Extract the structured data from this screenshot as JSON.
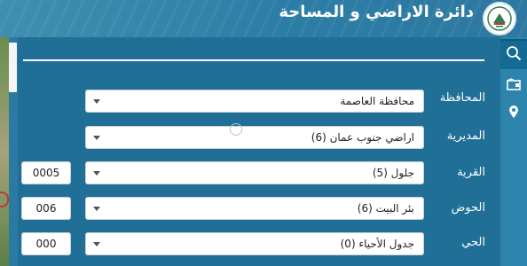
{
  "header": {
    "title": "دائرة الاراضي و المساحة",
    "logo_icon": "land-survey-logo"
  },
  "rail": {
    "items": [
      {
        "icon": "search-icon",
        "active": true
      },
      {
        "icon": "folder-icon",
        "active": false
      },
      {
        "icon": "location-pin-icon",
        "active": false
      }
    ]
  },
  "form": {
    "rows": [
      {
        "label": "المحافظة",
        "value": "محافظة العاصمة",
        "code": null
      },
      {
        "label": "المديرية",
        "value": "اراضي جنوب عمان (6)",
        "code": null
      },
      {
        "label": "القرية",
        "value": "جلول (5)",
        "code": "0005"
      },
      {
        "label": "الحوض",
        "value": "بئر البيت (6)",
        "code": "006"
      },
      {
        "label": "الحي",
        "value": "جدول الأحياء (0)",
        "code": "000"
      }
    ]
  },
  "colors": {
    "panel": "#1f6f97",
    "header": "#2c7da6",
    "rail": "#2d84ad",
    "text": "#ffffff"
  }
}
